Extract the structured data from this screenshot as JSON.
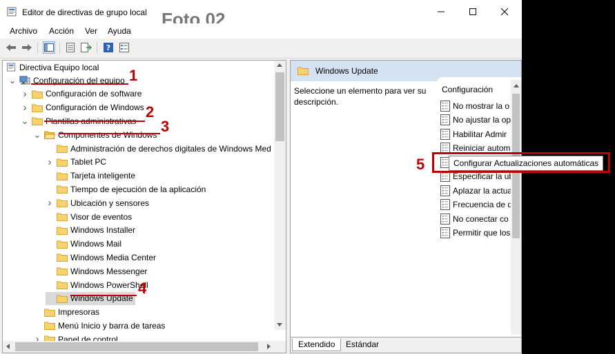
{
  "window": {
    "title": "Editor de directivas de grupo local",
    "photo_label": "Foto 02",
    "controls": {
      "minimize": "—",
      "maximize": "☐",
      "close": "✕"
    }
  },
  "menu": [
    "Archivo",
    "Acción",
    "Ver",
    "Ayuda"
  ],
  "toolbar_icons": [
    "back-arrow-icon",
    "forward-arrow-icon",
    "show-hide-tree-icon",
    "properties-icon",
    "export-list-icon",
    "help-icon",
    "filter-icon"
  ],
  "tree": {
    "root": "Directiva Equipo local",
    "items": [
      {
        "label": "Configuración del equipo",
        "level": 1,
        "expander": "expanded",
        "icon": "computer-icon"
      },
      {
        "label": "Configuración de software",
        "level": 2,
        "expander": "collapsed",
        "icon": "folder-icon"
      },
      {
        "label": "Configuración de Windows",
        "level": 2,
        "expander": "collapsed",
        "icon": "folder-icon"
      },
      {
        "label": "Plantillas administrativas",
        "level": 2,
        "expander": "expanded",
        "icon": "folder-icon"
      },
      {
        "label": "Componentes de Windows",
        "level": 3,
        "expander": "expanded",
        "icon": "folder-open-icon"
      },
      {
        "label": "Administración de derechos digitales de Windows Med",
        "level": 4,
        "expander": "none",
        "icon": "folder-icon"
      },
      {
        "label": "Tablet PC",
        "level": 4,
        "expander": "collapsed",
        "icon": "folder-icon"
      },
      {
        "label": "Tarjeta inteligente",
        "level": 4,
        "expander": "none",
        "icon": "folder-icon"
      },
      {
        "label": "Tiempo de ejecución de la aplicación",
        "level": 4,
        "expander": "none",
        "icon": "folder-icon"
      },
      {
        "label": "Ubicación y sensores",
        "level": 4,
        "expander": "collapsed",
        "icon": "folder-icon"
      },
      {
        "label": "Visor de eventos",
        "level": 4,
        "expander": "none",
        "icon": "folder-icon"
      },
      {
        "label": "Windows Installer",
        "level": 4,
        "expander": "none",
        "icon": "folder-icon"
      },
      {
        "label": "Windows Mail",
        "level": 4,
        "expander": "none",
        "icon": "folder-icon"
      },
      {
        "label": "Windows Media Center",
        "level": 4,
        "expander": "none",
        "icon": "folder-icon"
      },
      {
        "label": "Windows Messenger",
        "level": 4,
        "expander": "none",
        "icon": "folder-icon"
      },
      {
        "label": "Windows PowerShell",
        "level": 4,
        "expander": "none",
        "icon": "folder-icon"
      },
      {
        "label": "Windows Update",
        "level": 4,
        "expander": "none",
        "icon": "folder-icon",
        "selected": true
      },
      {
        "label": "Impresoras",
        "level": 3,
        "expander": "none",
        "icon": "folder-icon"
      },
      {
        "label": "Menú Inicio y barra de tareas",
        "level": 3,
        "expander": "none",
        "icon": "folder-icon"
      },
      {
        "label": "Panel de control",
        "level": 3,
        "expander": "collapsed",
        "icon": "folder-icon"
      }
    ]
  },
  "right_pane": {
    "header": "Windows Update",
    "description": "Seleccione un elemento para ver su descripción.",
    "column_header": "Configuración",
    "settings": [
      "No mostrar la o",
      "No ajustar la op",
      "Habilitar Admir",
      "Reiniciar autom",
      "",
      "Especificar la ub",
      "Aplazar la actua",
      "Frecuencia de d",
      "No conectar co",
      "Permitir que los"
    ],
    "tooltip": "Configurar Actualizaciones automáticas",
    "tabs": [
      "Extendido",
      "Estándar"
    ]
  },
  "annotations": [
    "1",
    "2",
    "3",
    "4",
    "5"
  ],
  "colors": {
    "annotation_red": "#c00000",
    "folder_yellow": "#f7d36b",
    "selected_bg": "#d9d9d9",
    "header_blue": "#d4e2f1"
  }
}
